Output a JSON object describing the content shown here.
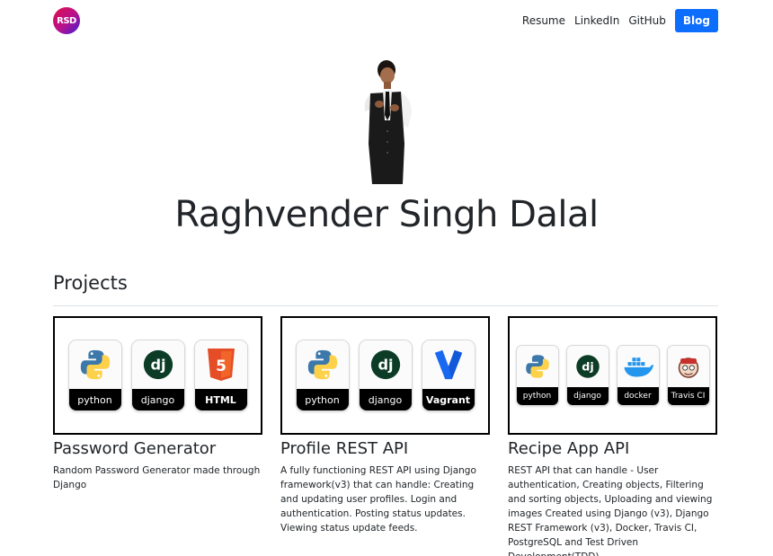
{
  "brand": {
    "logo_text": "RSD"
  },
  "nav": {
    "links": [
      "Resume",
      "LinkedIn",
      "GitHub"
    ],
    "blog_label": "Blog"
  },
  "hero": {
    "name": "Raghvender Singh Dalal"
  },
  "projects": {
    "title": "Projects",
    "cards": [
      {
        "title": "Password Generator",
        "description": "Random Password Generator made through Django",
        "badges": [
          "python",
          "django",
          "HTML"
        ]
      },
      {
        "title": "Profile REST API",
        "description": "A fully functioning REST API using Django framework(v3) that can handle: Creating and updating user profiles. Login and authentication. Posting status updates. Viewing status update feeds.",
        "badges": [
          "python",
          "django",
          "Vagrant"
        ]
      },
      {
        "title": "Recipe App API",
        "description": "REST API that can handle - User authentication, Creating objects, Filtering and sorting objects, Uploading and viewing images Created using Django (v3), Django REST Framework (v3), Docker, Travis CI, PostgreSQL and Test Driven Development(TDD)",
        "badges": [
          "python",
          "django",
          "docker",
          "Travis CI"
        ]
      }
    ]
  },
  "colors": {
    "accent": "#0d6efd",
    "text": "#212529",
    "django_green": "#0c3c26",
    "html_orange": "#e44d26",
    "vagrant_blue": "#1868f2",
    "docker_blue": "#2496ed"
  }
}
